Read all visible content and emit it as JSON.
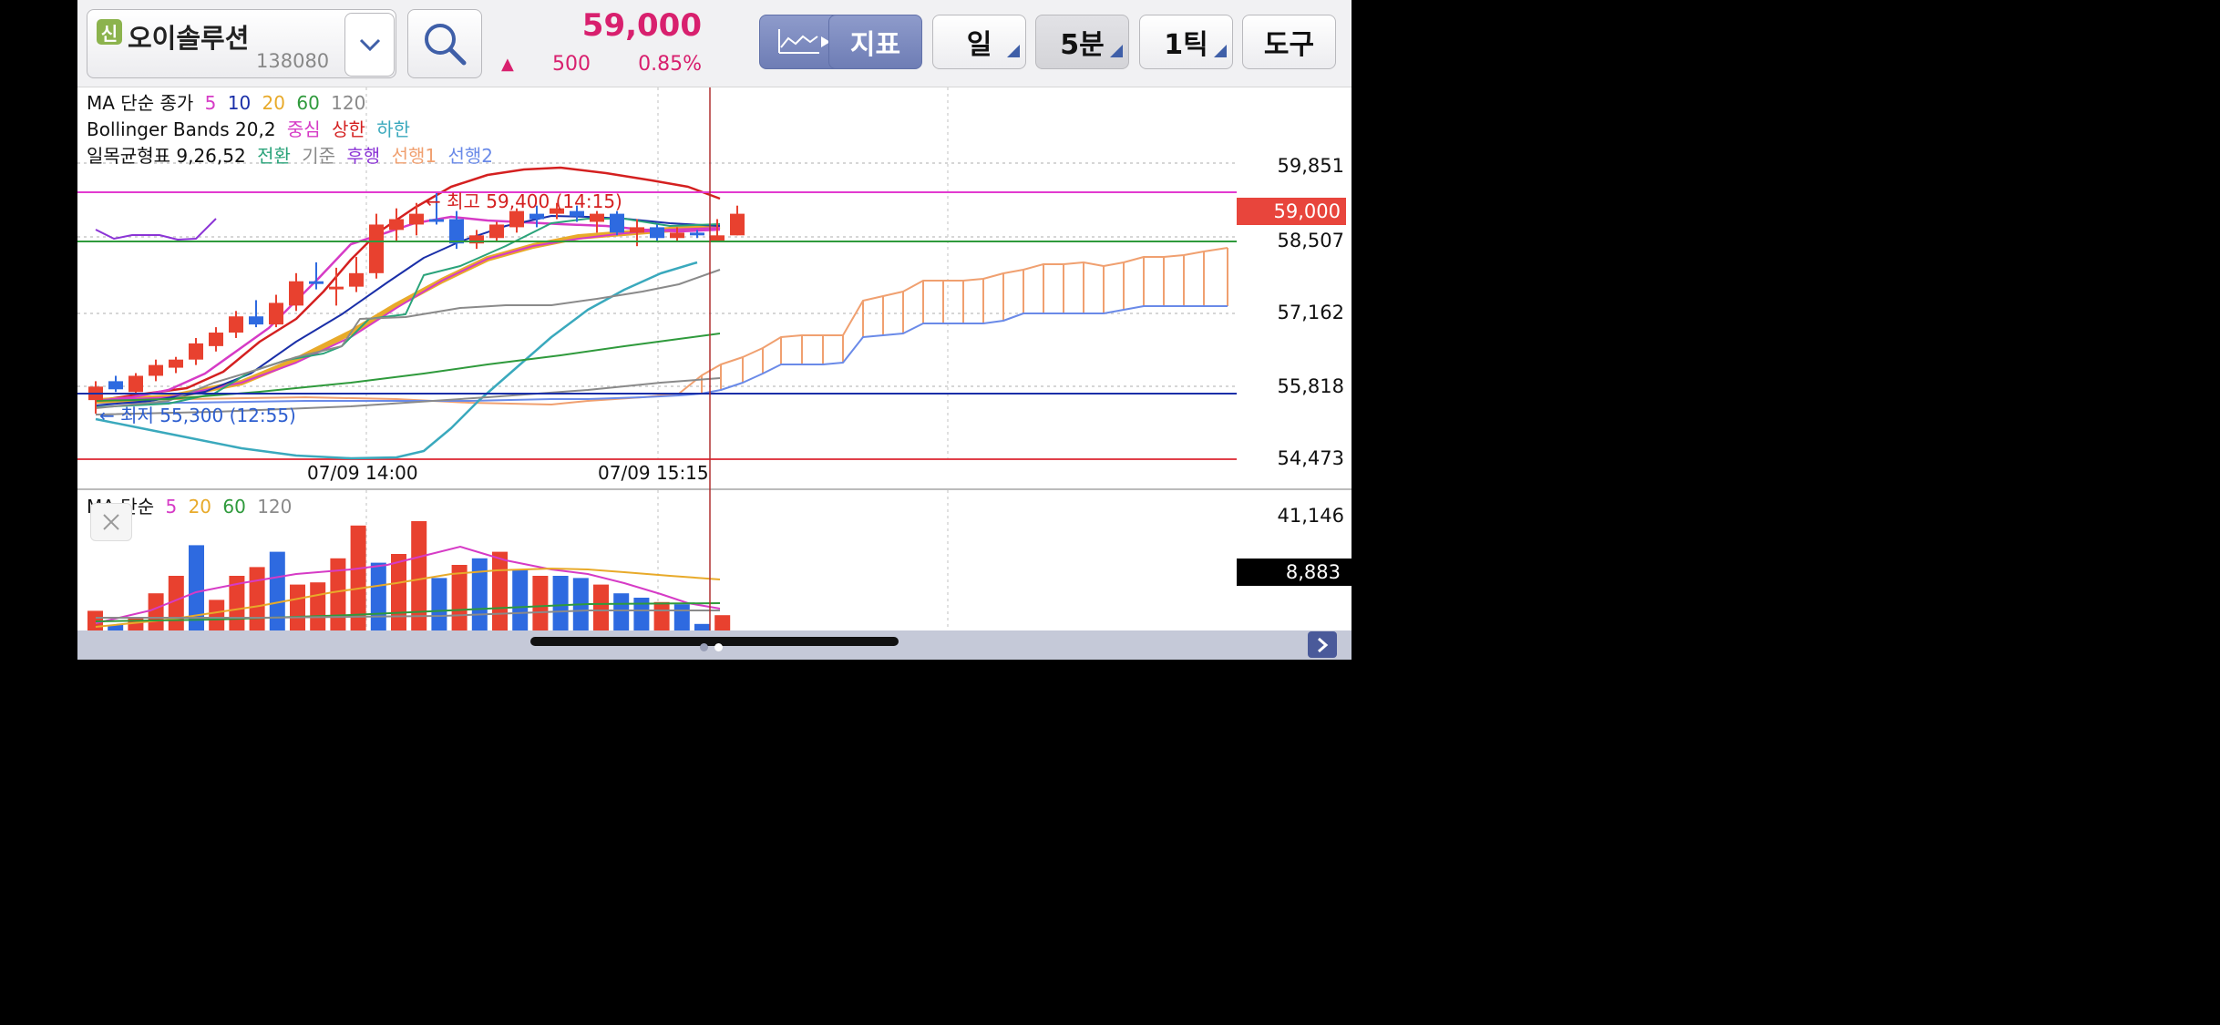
{
  "stock": {
    "badge": "신",
    "name": "오이솔루션",
    "code": "138080",
    "price": "59,000",
    "change_arrow": "▲",
    "change": "500",
    "change_pct": "0.85%"
  },
  "toolbar": {
    "indicator": "지표",
    "day": "일",
    "interval": "5분",
    "tick": "1틱",
    "tools": "도구"
  },
  "legend": {
    "ma_title": "MA 단순 종가",
    "ma_periods": [
      "5",
      "10",
      "20",
      "60",
      "120"
    ],
    "bb_title": "Bollinger Bands 20,2",
    "bb_items": [
      "중심",
      "상한",
      "하한"
    ],
    "ichi_title": "일목균형표 9,26,52",
    "ichi_items": [
      "전환",
      "기준",
      "후행",
      "선행1",
      "선행2"
    ],
    "vol_title": "MA 단순",
    "vol_periods": [
      "5",
      "20",
      "60",
      "120"
    ]
  },
  "annotations": {
    "high": "← 최고 59,400 (14:15)",
    "low": "← 최저 55,300 (12:55)"
  },
  "axis": {
    "price_ticks": [
      "59,851",
      "58,507",
      "57,162",
      "55,818",
      "54,473"
    ],
    "current_price": "59,000",
    "time_labels": [
      "07/09 14:00",
      "07/09 15:15"
    ],
    "volume_ticks": [
      "41,146"
    ],
    "current_volume": "8,883"
  },
  "colors": {
    "up": "#e8412f",
    "down": "#2e6ae0",
    "ma5": "#d63bc6",
    "ma10": "#1a2fa8",
    "ma20": "#e8aa2a",
    "ma60": "#2f9a3c",
    "ma120": "#8a8a8a",
    "bb_upper": "#d42020",
    "bb_lower": "#3aa9bd",
    "ichi_conv": "#2aa37a",
    "ichi_lag": "#8b34d6",
    "span1": "#f0a070",
    "span2": "#6a8ae8",
    "price_box": "#e8453c"
  },
  "chart_data": {
    "type": "candlestick",
    "price_range": [
      54473,
      60400
    ],
    "high": 59400,
    "low": 55300,
    "candles": [
      {
        "o": 55550,
        "h": 55900,
        "l": 55300,
        "c": 55800
      },
      {
        "o": 55900,
        "h": 56000,
        "l": 55700,
        "c": 55750
      },
      {
        "o": 55700,
        "h": 56050,
        "l": 55650,
        "c": 56000
      },
      {
        "o": 56000,
        "h": 56300,
        "l": 55900,
        "c": 56200
      },
      {
        "o": 56150,
        "h": 56350,
        "l": 56050,
        "c": 56300
      },
      {
        "o": 56300,
        "h": 56700,
        "l": 56200,
        "c": 56600
      },
      {
        "o": 56550,
        "h": 56900,
        "l": 56450,
        "c": 56800
      },
      {
        "o": 56800,
        "h": 57200,
        "l": 56700,
        "c": 57100
      },
      {
        "o": 57100,
        "h": 57400,
        "l": 56900,
        "c": 56950
      },
      {
        "o": 56950,
        "h": 57500,
        "l": 56900,
        "c": 57350
      },
      {
        "o": 57300,
        "h": 57900,
        "l": 57200,
        "c": 57750
      },
      {
        "o": 57750,
        "h": 58100,
        "l": 57600,
        "c": 57700
      },
      {
        "o": 57600,
        "h": 58000,
        "l": 57300,
        "c": 57650
      },
      {
        "o": 57650,
        "h": 58200,
        "l": 57550,
        "c": 57900
      },
      {
        "o": 57900,
        "h": 59000,
        "l": 57800,
        "c": 58800
      },
      {
        "o": 58700,
        "h": 59100,
        "l": 58500,
        "c": 58900
      },
      {
        "o": 58800,
        "h": 59200,
        "l": 58600,
        "c": 59000
      },
      {
        "o": 58900,
        "h": 59400,
        "l": 58800,
        "c": 58850
      },
      {
        "o": 58900,
        "h": 59050,
        "l": 58350,
        "c": 58450
      },
      {
        "o": 58450,
        "h": 58700,
        "l": 58350,
        "c": 58600
      },
      {
        "o": 58550,
        "h": 58850,
        "l": 58500,
        "c": 58800
      },
      {
        "o": 58750,
        "h": 59100,
        "l": 58650,
        "c": 59050
      },
      {
        "o": 59000,
        "h": 59150,
        "l": 58750,
        "c": 58900
      },
      {
        "o": 59000,
        "h": 59200,
        "l": 58900,
        "c": 59100
      },
      {
        "o": 59050,
        "h": 59150,
        "l": 58850,
        "c": 58950
      },
      {
        "o": 58850,
        "h": 59050,
        "l": 58650,
        "c": 59000
      },
      {
        "o": 59000,
        "h": 59050,
        "l": 58600,
        "c": 58650
      },
      {
        "o": 58650,
        "h": 58900,
        "l": 58400,
        "c": 58750
      },
      {
        "o": 58750,
        "h": 58800,
        "l": 58500,
        "c": 58550
      },
      {
        "o": 58550,
        "h": 58750,
        "l": 58500,
        "c": 58650
      },
      {
        "o": 58650,
        "h": 58700,
        "l": 58550,
        "c": 58600
      },
      {
        "o": 58500,
        "h": 58900,
        "l": 58500,
        "c": 58600
      },
      {
        "o": 58600,
        "h": 59150,
        "l": 58600,
        "c": 59000
      }
    ],
    "volumes": [
      9000,
      2500,
      6000,
      17000,
      25000,
      39000,
      14000,
      25000,
      29000,
      36000,
      21000,
      22000,
      33000,
      48000,
      31000,
      35000,
      50000,
      24000,
      30000,
      33000,
      36000,
      28000,
      25000,
      25000,
      24000,
      21000,
      17000,
      15000,
      13000,
      12000,
      3000,
      7000
    ],
    "volume_up": [
      true,
      false,
      true,
      true,
      true,
      false,
      true,
      true,
      true,
      false,
      true,
      true,
      true,
      true,
      false,
      true,
      true,
      false,
      true,
      false,
      true,
      false,
      true,
      false,
      false,
      true,
      false,
      false,
      true,
      false,
      false,
      true
    ]
  }
}
